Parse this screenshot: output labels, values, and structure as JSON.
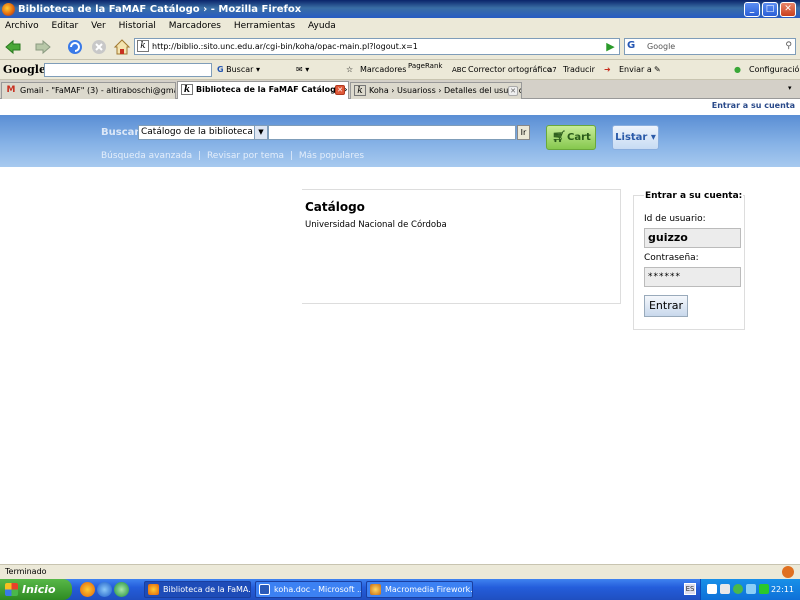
{
  "window": {
    "title": "Biblioteca de la FaMAF Catálogo › - Mozilla Firefox"
  },
  "menu": [
    "Archivo",
    "Editar",
    "Ver",
    "Historial",
    "Marcadores",
    "Herramientas",
    "Ayuda"
  ],
  "nav": {
    "url": "http://biblio.:sito.unc.edu.ar/cgi-bin/koha/opac-main.pl?logout.x=1",
    "search_placeholder": "Google"
  },
  "googlebar": {
    "logo": "Google",
    "buscar": "Buscar",
    "marcadores": "Marcadores",
    "pagerank": "PageRank",
    "corrector": "Corrector ortográfico",
    "traducir": "Traducir",
    "enviar": "Enviar a",
    "configuracion": "Configuración"
  },
  "tabs": [
    {
      "label": "Gmail - \"FaMAF\" (3) - altiraboschi@gma...",
      "icon": "gmail-icon"
    },
    {
      "label": "Biblioteca de la FaMAF Catálogo ›",
      "icon": "koha-icon",
      "active": true
    },
    {
      "label": "Koha › Usuarioss › Detalles del usuario...",
      "icon": "koha-icon"
    }
  ],
  "page": {
    "login_link": "Entrar a su cuenta",
    "buscar_label": "Buscar",
    "catalog_select": "Catálogo de la biblioteca",
    "ir_button": "Ir",
    "cart_button": "Cart",
    "listar_button": "Listar ▾",
    "links": {
      "advanced": "Búsqueda avanzada",
      "sep1": "|",
      "browse": "Revisar por tema",
      "sep2": "|",
      "popular": "Más populares"
    },
    "catalog": {
      "title": "Catálogo",
      "subtitle": "Universidad Nacional de Córdoba"
    },
    "login": {
      "title": "Entrar a su cuenta:",
      "user_label": "Id de usuario:",
      "user_value": "guizzo",
      "pass_label": "Contraseña:",
      "pass_value": "******",
      "submit": "Entrar"
    }
  },
  "status": {
    "text": "Terminado"
  },
  "taskbar": {
    "start": "Inicio",
    "tasks": [
      {
        "label": "Biblioteca de la FaMA...",
        "active": true
      },
      {
        "label": "koha.doc - Microsoft ..."
      },
      {
        "label": "Macromedia Firework..."
      }
    ],
    "clock": "22:11"
  },
  "colors": {
    "header_blue": "#6b9ddc",
    "cart_green": "#86c84e",
    "link_blue": "#2a4a8a"
  }
}
